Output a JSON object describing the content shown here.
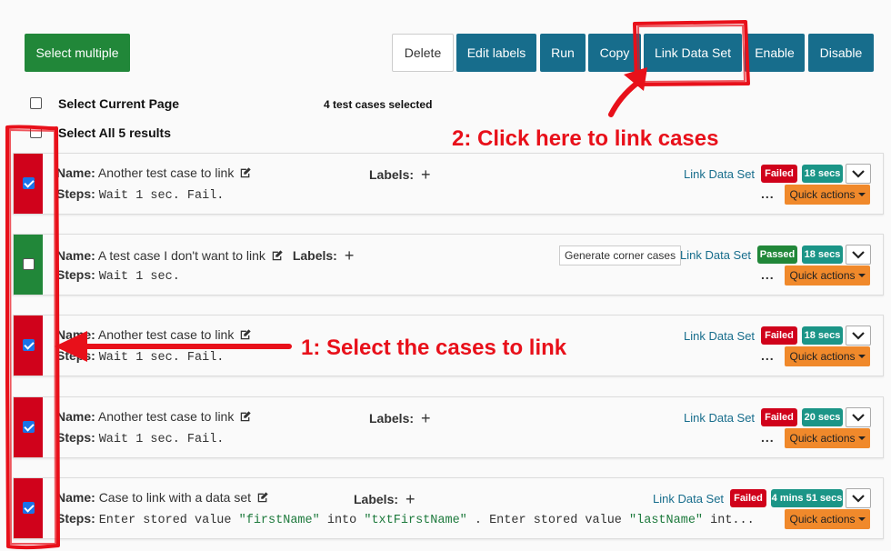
{
  "toolbar": {
    "select_multiple": "Select multiple",
    "delete": "Delete",
    "edit_labels": "Edit labels",
    "run": "Run",
    "copy": "Copy",
    "link_data_set": "Link Data Set",
    "enable": "Enable",
    "disable": "Disable"
  },
  "selection": {
    "select_current_page": "Select Current Page",
    "select_all": "Select All 5 results",
    "selected_count": "4 test cases selected"
  },
  "common": {
    "name_label": "Name:",
    "steps_label": "Steps:",
    "labels_label": "Labels:",
    "plus": "+",
    "link_data_set": "Link Data Set",
    "quick_actions": "Quick actions",
    "more": "..."
  },
  "rows": [
    {
      "name": "Another test case to link",
      "steps": "Wait 1 sec. Fail.",
      "status": "Failed",
      "duration": "18 secs",
      "checked": true
    },
    {
      "name": "A test case I don't want to link",
      "steps": "Wait 1 sec.",
      "status": "Passed",
      "duration": "18 secs",
      "checked": false,
      "extra_button": "Generate corner cases"
    },
    {
      "name": "Another test case to link",
      "steps": "Wait 1 sec. Fail.",
      "status": "Failed",
      "duration": "18 secs",
      "checked": true
    },
    {
      "name": "Another test case to link",
      "steps": "Wait 1 sec. Fail.",
      "status": "Failed",
      "duration": "20 secs",
      "checked": true
    },
    {
      "name": "Case to link with a data set",
      "steps_parts": [
        "Enter stored value ",
        "\"firstName\"",
        " into ",
        "\"txtFirstName\"",
        " . Enter stored value ",
        "\"lastName\"",
        " int..."
      ],
      "status": "Failed",
      "duration": "4 mins 51 secs",
      "checked": true
    }
  ],
  "annotations": {
    "step1": "1: Select the cases to link",
    "step2": "2: Click here to link cases",
    "color": "#e8101a"
  },
  "colors": {
    "green": "#218739",
    "blue": "#176d8c",
    "failed": "#d0021b",
    "time": "#1b9587",
    "quick_actions": "#f0892b"
  }
}
